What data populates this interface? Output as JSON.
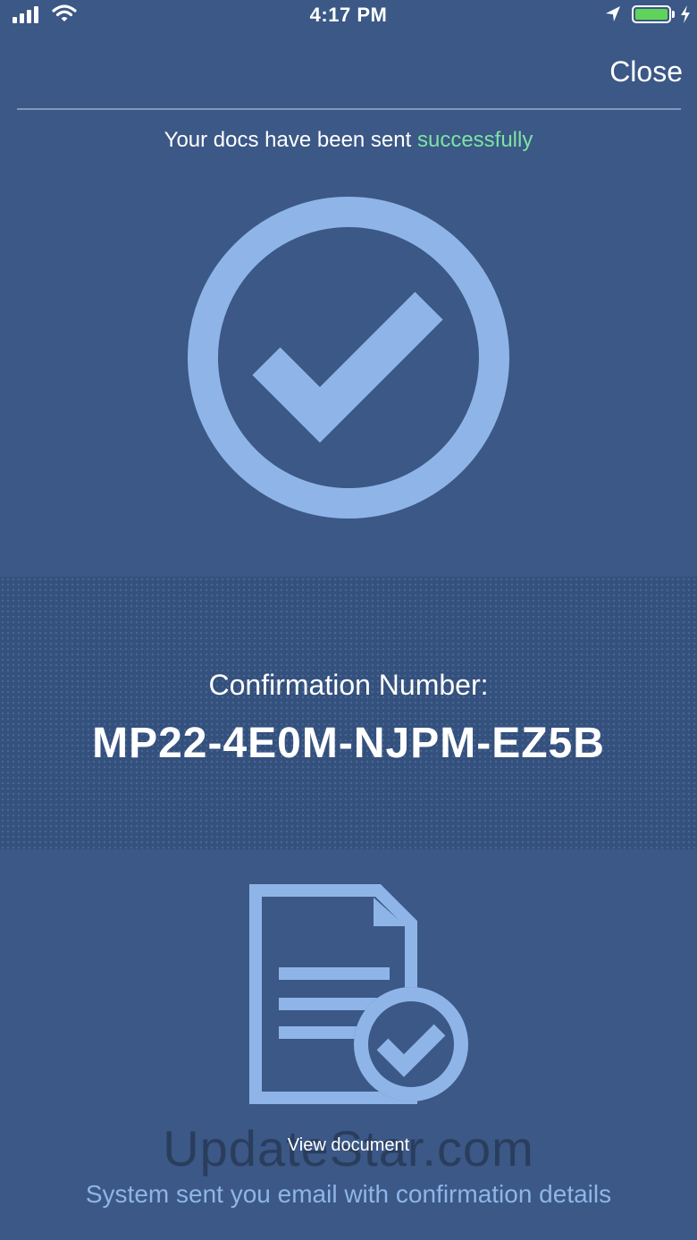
{
  "status_bar": {
    "time": "4:17 PM",
    "icons": [
      "signal-icon",
      "wifi-icon",
      "location-arrow-icon",
      "battery-icon",
      "charging-bolt-icon"
    ],
    "battery_level": 1.0
  },
  "header": {
    "close_label": "Close"
  },
  "message": {
    "prefix": "Your docs have been sent",
    "status_word": "successfully"
  },
  "confirmation": {
    "label": "Confirmation Number:",
    "number": "MP22-4E0M-NJPM-EZ5B"
  },
  "document": {
    "icon": "document-check-icon",
    "view_label": "View document"
  },
  "watermark": "UpdateStar.com",
  "footer": {
    "note": "System sent you email with confirmation details"
  },
  "colors": {
    "background": "#3b5886",
    "accent_light_blue": "#8fb5e8",
    "success_green": "#7de3a4",
    "battery_green": "#5fd35a"
  }
}
